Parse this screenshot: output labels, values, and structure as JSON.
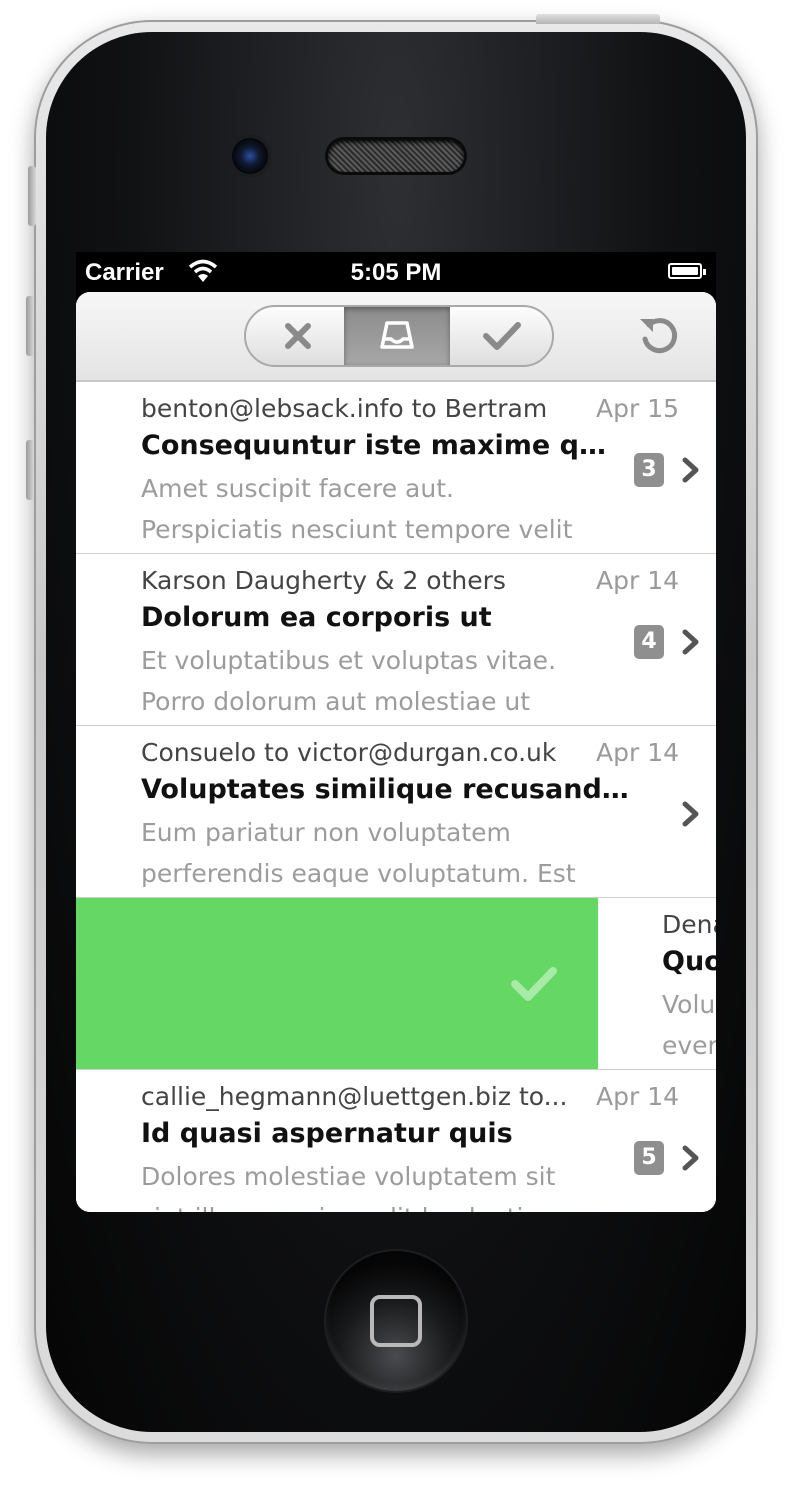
{
  "status_bar": {
    "carrier": "Carrier",
    "time": "5:05 PM"
  },
  "toolbar": {
    "segments": [
      {
        "name": "trash",
        "icon": "x-icon",
        "selected": false
      },
      {
        "name": "inbox",
        "icon": "inbox-tray-icon",
        "selected": true
      },
      {
        "name": "archive",
        "icon": "checkmark-icon",
        "selected": false
      }
    ],
    "refresh_icon": "refresh-icon"
  },
  "threads": [
    {
      "from": "benton@lebsack.info to Bertram",
      "date": "Apr 15",
      "subject": "Consequuntur iste maxime qui...",
      "preview": "Amet suscipit facere aut. Perspiciatis nesciunt tempore velit",
      "count": "3"
    },
    {
      "from": "Karson Daugherty & 2 others",
      "date": "Apr 14",
      "subject": "Dolorum ea corporis ut",
      "preview": "Et voluptatibus et voluptas vitae. Porro dolorum aut molestiae ut",
      "count": "4"
    },
    {
      "from": "Consuelo to victor@durgan.co.uk",
      "date": "Apr 14",
      "subject": "Voluptates similique recusandae...",
      "preview": "Eum pariatur non voluptatem perferendis eaque voluptatum. Est",
      "count": ""
    },
    {
      "from": "callie_hegmann@luettgen.biz to...",
      "date": "Apr 14",
      "subject": "Id quasi aspernatur quis",
      "preview": "Dolores molestiae voluptatem sit sint illum quo impedit laudantium",
      "count": "5"
    }
  ],
  "swiped_thread": {
    "from": "Dena",
    "subject": "Quo",
    "preview_line1": "Volu",
    "preview_line2": "ever",
    "action_color": "#64d764",
    "action_icon": "checkmark-icon"
  }
}
